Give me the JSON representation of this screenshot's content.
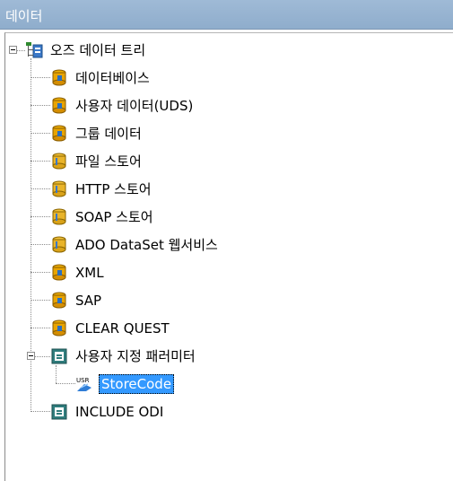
{
  "panel": {
    "title": "데이터"
  },
  "tree": {
    "root": {
      "label": "오즈 데이터 트리",
      "icon": "tree-root-icon"
    },
    "stores": [
      {
        "label": "데이터베이스",
        "icon": "database-store-icon"
      },
      {
        "label": "사용자 데이터(UDS)",
        "icon": "database-store-icon"
      },
      {
        "label": "그룹 데이터",
        "icon": "database-store-icon"
      },
      {
        "label": "파일 스토어",
        "icon": "store-cylinder-icon"
      },
      {
        "label": "HTTP 스토어",
        "icon": "store-cylinder-icon"
      },
      {
        "label": "SOAP 스토어",
        "icon": "store-cylinder-icon"
      },
      {
        "label": "ADO DataSet 웹서비스",
        "icon": "store-cylinder-icon"
      },
      {
        "label": "XML",
        "icon": "database-store-icon"
      },
      {
        "label": "SAP",
        "icon": "database-store-icon"
      },
      {
        "label": "CLEAR QUEST",
        "icon": "database-store-icon"
      }
    ],
    "user_param": {
      "label": "사용자 지정 패러미터",
      "icon": "parameter-folder-icon",
      "child": {
        "label": "StoreCode",
        "icon": "user-parameter-icon",
        "selected": true
      }
    },
    "include_odi": {
      "label": "INCLUDE ODI",
      "icon": "parameter-folder-icon"
    }
  },
  "colors": {
    "titlebar": "#9fbad6",
    "selection": "#3399ff"
  }
}
